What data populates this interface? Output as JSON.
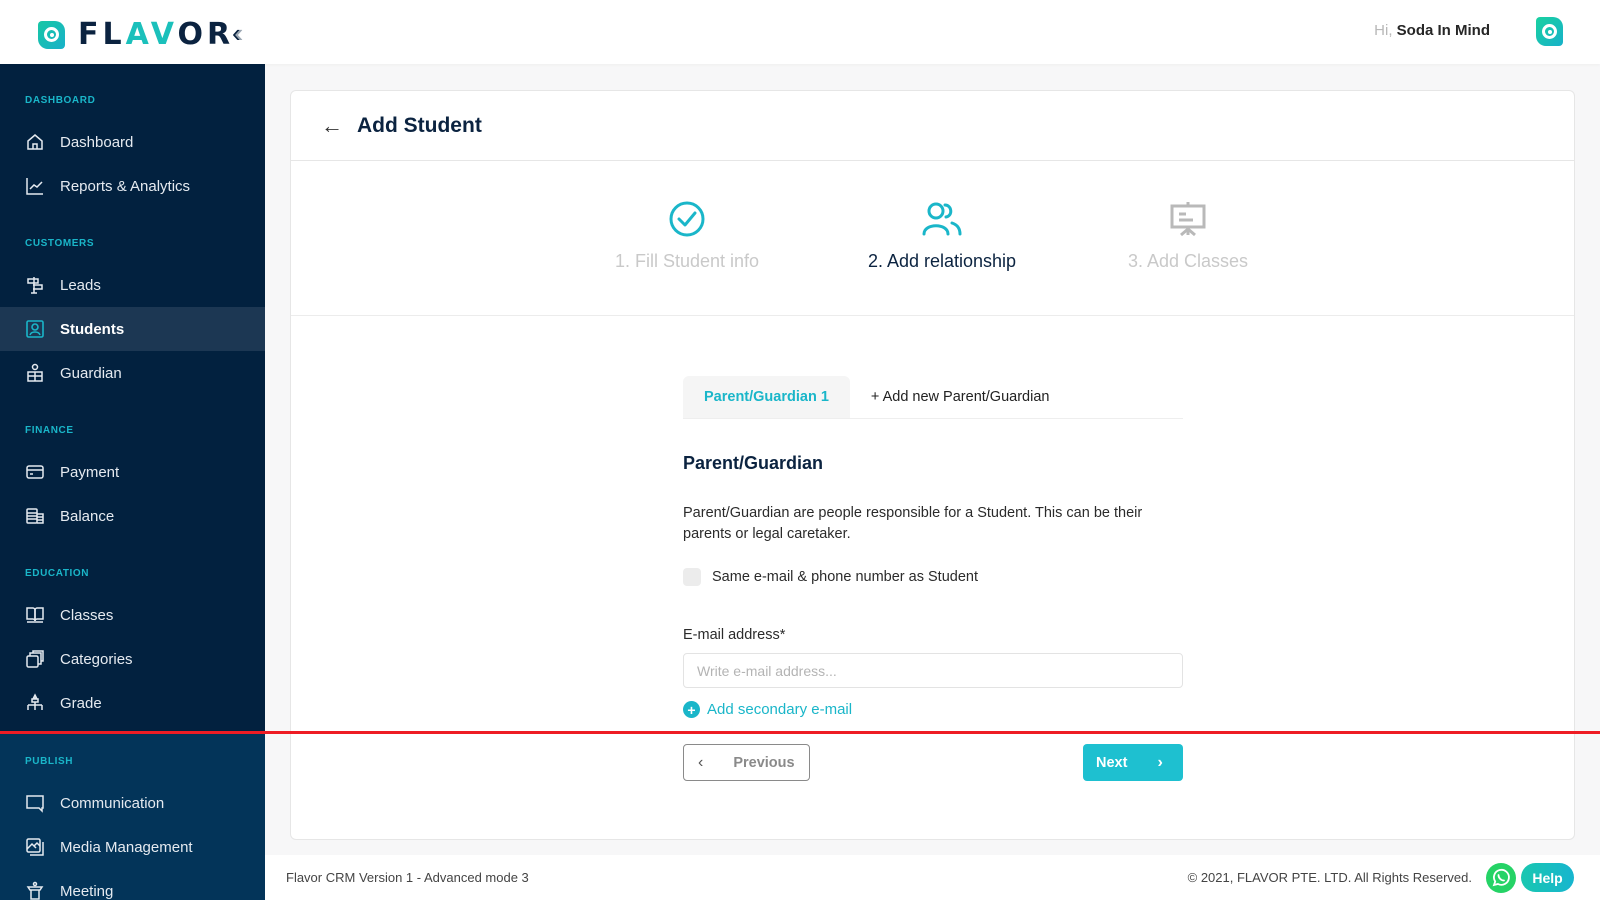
{
  "header": {
    "logo_text_pre": "FL",
    "logo_text_accent": "AV",
    "logo_text_post": "OR",
    "collapse_icon": "double-chevron-left",
    "greeting": "Hi,",
    "user_name": "Soda In Mind"
  },
  "sidebar": {
    "sections": [
      {
        "label": "DASHBOARD",
        "items": [
          {
            "label": "Dashboard",
            "icon": "home-icon"
          },
          {
            "label": "Reports & Analytics",
            "icon": "chart-line-icon"
          }
        ]
      },
      {
        "label": "CUSTOMERS",
        "items": [
          {
            "label": "Leads",
            "icon": "signpost-icon"
          },
          {
            "label": "Students",
            "icon": "user-card-icon",
            "active": true
          },
          {
            "label": "Guardian",
            "icon": "guardian-icon"
          }
        ]
      },
      {
        "label": "FINANCE",
        "items": [
          {
            "label": "Payment",
            "icon": "credit-card-icon"
          },
          {
            "label": "Balance",
            "icon": "coins-stack-icon"
          }
        ]
      },
      {
        "label": "EDUCATION",
        "items": [
          {
            "label": "Classes",
            "icon": "book-open-icon"
          },
          {
            "label": "Categories",
            "icon": "layers-icon"
          },
          {
            "label": "Grade",
            "icon": "hierarchy-icon"
          }
        ]
      },
      {
        "label": "PUBLISH",
        "items": [
          {
            "label": "Communication",
            "icon": "chat-bubble-icon"
          },
          {
            "label": "Media Management",
            "icon": "image-gallery-icon"
          },
          {
            "label": "Meeting",
            "icon": "podium-icon"
          }
        ]
      }
    ]
  },
  "page": {
    "title": "Add Student",
    "steps": [
      {
        "label": "1. Fill Student info",
        "state": "done",
        "icon": "check-circle-icon"
      },
      {
        "label": "2. Add relationship",
        "state": "current",
        "icon": "users-icon"
      },
      {
        "label": "3. Add Classes",
        "state": "todo",
        "icon": "presentation-board-icon"
      }
    ],
    "tabs": [
      {
        "label": "Parent/Guardian 1",
        "active": true
      },
      {
        "label": "+ Add new Parent/Guardian",
        "active": false
      }
    ],
    "section_title": "Parent/Guardian",
    "description": "Parent/Guardian are people responsible for a Student. This can be their parents or legal caretaker.",
    "same_contact_checkbox": {
      "label": "Same e-mail & phone number as Student",
      "checked": false
    },
    "email_field": {
      "label": "E-mail address*",
      "value": "",
      "placeholder": "Write e-mail address..."
    },
    "add_secondary_email": "Add secondary e-mail",
    "prev_button": "Previous",
    "next_button": "Next"
  },
  "footer": {
    "version": "Flavor CRM Version 1 - Advanced mode 3",
    "copyright": "© 2021, FLAVOR PTE. LTD. All Rights Reserved.",
    "help": "Help"
  },
  "colors": {
    "brand_teal": "#1ab6c9",
    "sidebar_bg": "#02213f",
    "sidebar_active": "#1c3753",
    "title_navy": "#0b2340",
    "whatsapp_green": "#25d366",
    "divider_red": "#ee1c24"
  }
}
